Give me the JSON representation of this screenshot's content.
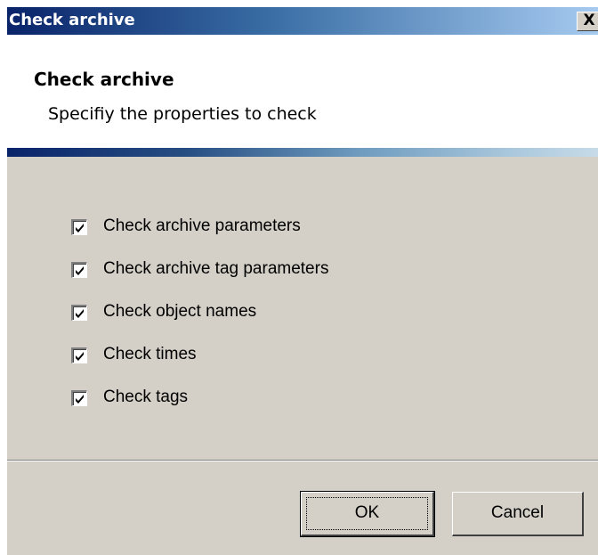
{
  "window": {
    "title": "Check archive",
    "close_glyph": "X"
  },
  "header": {
    "title": "Check archive",
    "subtitle": "Specifiy the properties to check"
  },
  "options": [
    {
      "label": "Check archive parameters",
      "checked": true
    },
    {
      "label": "Check archive tag parameters",
      "checked": true
    },
    {
      "label": "Check object names",
      "checked": true
    },
    {
      "label": "Check times",
      "checked": true
    },
    {
      "label": "Check tags",
      "checked": true
    }
  ],
  "buttons": {
    "ok": "OK",
    "cancel": "Cancel"
  },
  "icons": {
    "close": "close-icon",
    "checkmark": "checkmark-icon"
  }
}
